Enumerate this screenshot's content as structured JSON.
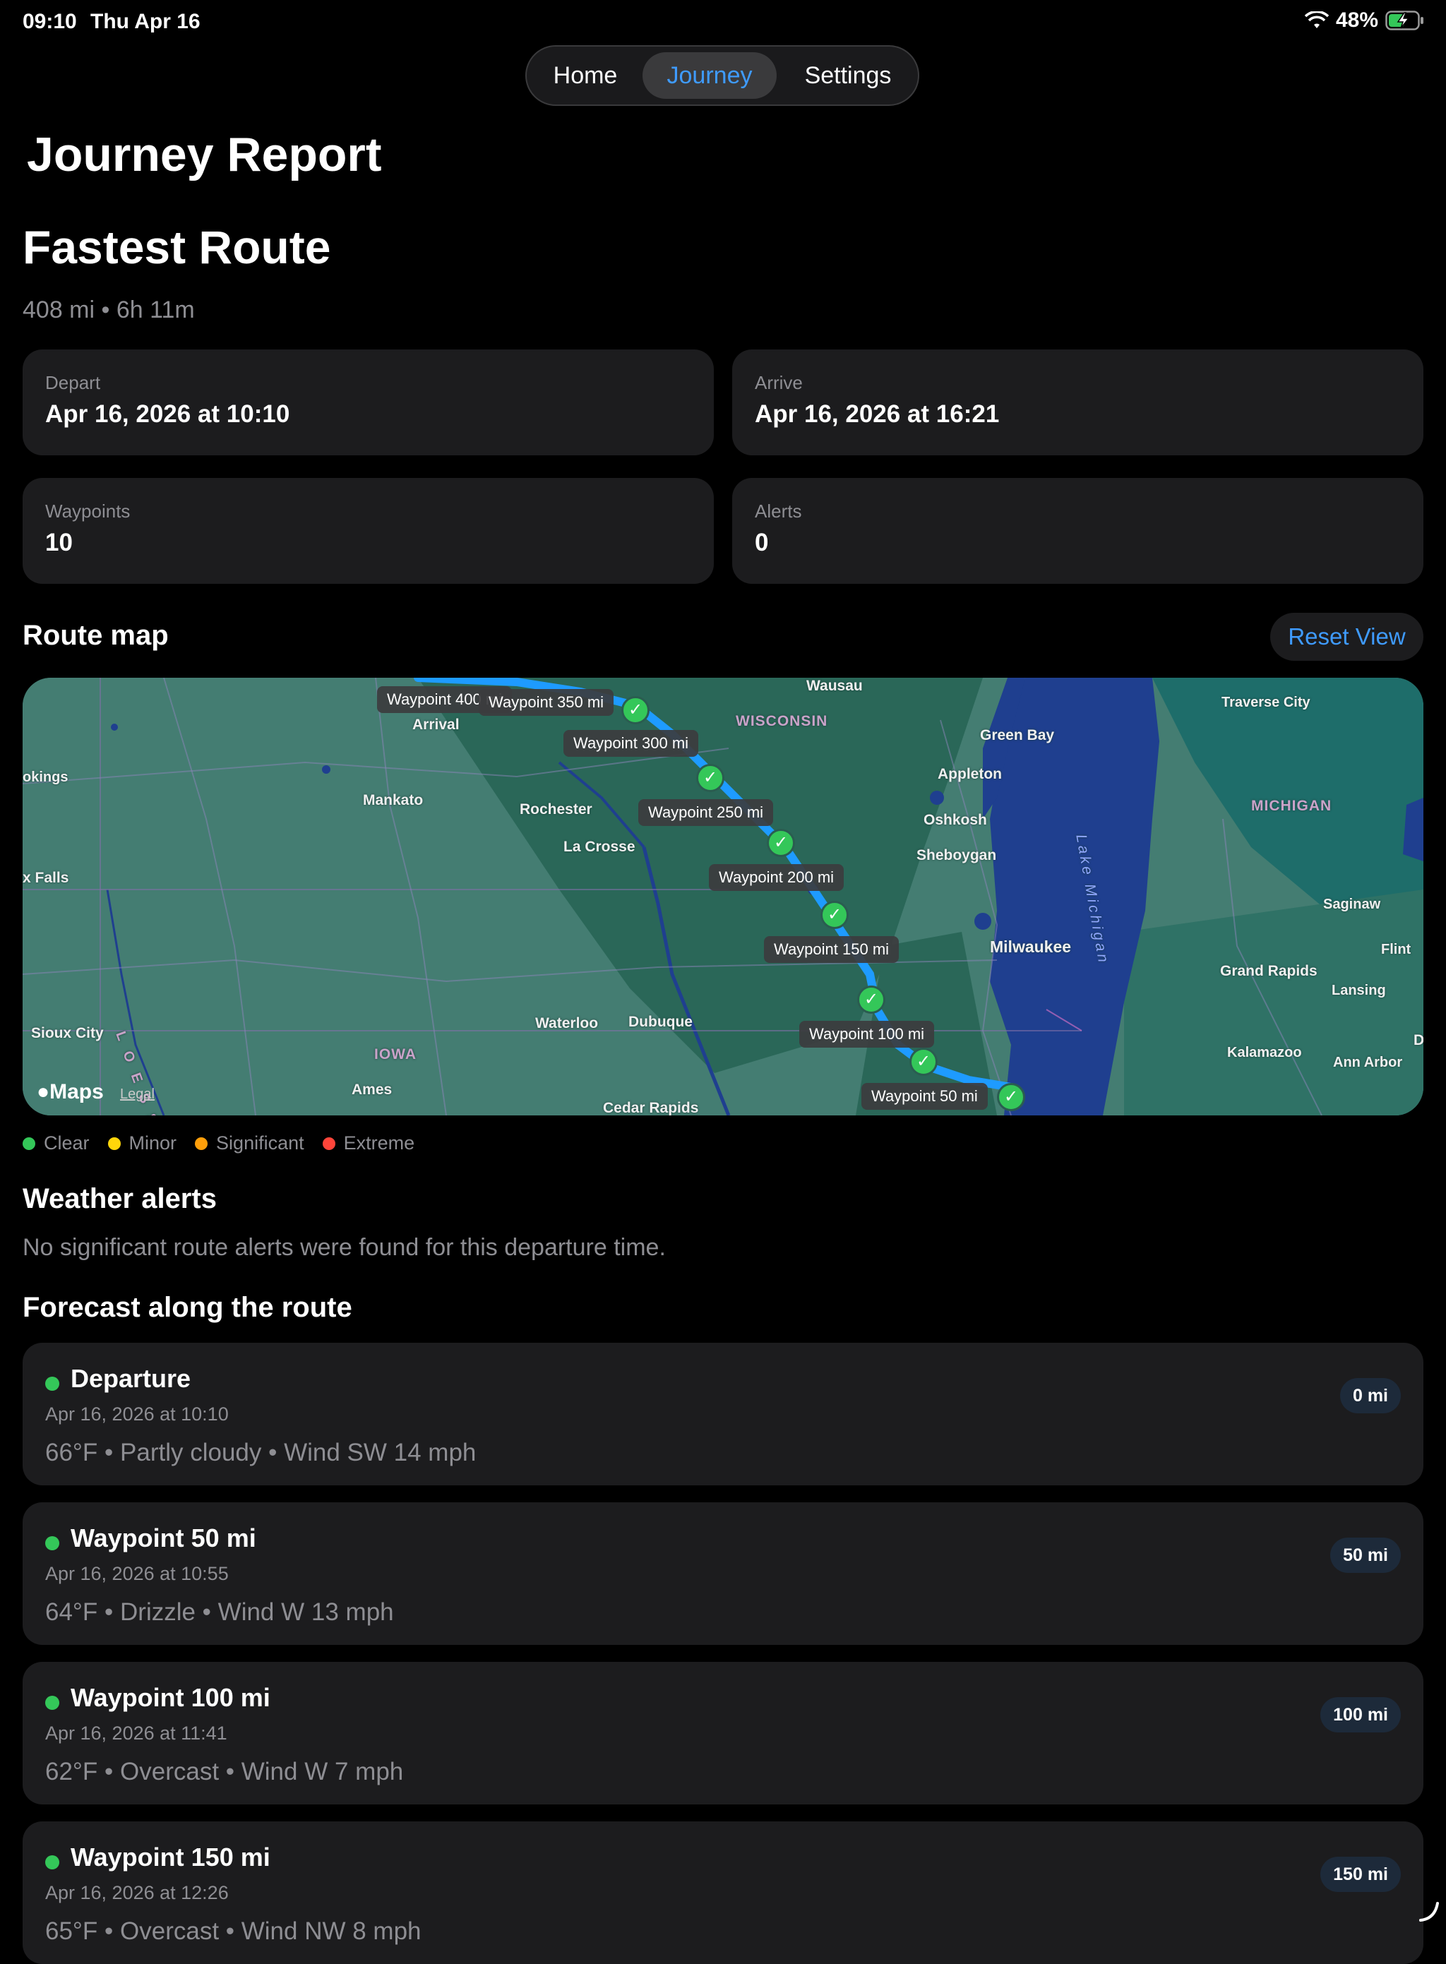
{
  "status_bar": {
    "time": "09:10",
    "date": "Thu Apr 16",
    "battery": "48%"
  },
  "tabs": {
    "home": "Home",
    "journey": "Journey",
    "settings": "Settings",
    "selected": "Journey"
  },
  "page_title": "Journey Report",
  "route": {
    "title": "Fastest Route",
    "summary": "408 mi • 6h 11m"
  },
  "stats": {
    "depart": {
      "label": "Depart",
      "value": "Apr 16, 2026 at 10:10"
    },
    "arrive": {
      "label": "Arrive",
      "value": "Apr 16, 2026 at 16:21"
    },
    "waypoints": {
      "label": "Waypoints",
      "value": "10"
    },
    "alerts": {
      "label": "Alerts",
      "value": "0"
    }
  },
  "route_map": {
    "heading": "Route map",
    "reset_label": "Reset View",
    "maps_brand": "Maps",
    "legal": "Legal",
    "waypoint_labels": [
      "Waypoint 400 mi",
      "Waypoint 350 mi",
      "Waypoint 300 mi",
      "Waypoint 250 mi",
      "Waypoint 200 mi",
      "Waypoint 150 mi",
      "Waypoint 100 mi",
      "Waypoint 50 mi"
    ],
    "places": {
      "wausau": "Wausau",
      "arrival": "Arrival",
      "wisconsin": "WISCONSIN",
      "green_bay": "Green Bay",
      "traverse_city": "Traverse City",
      "brookings": "okings",
      "mankato": "Mankato",
      "rochester": "Rochester",
      "appleton": "Appleton",
      "oshkosh": "Oshkosh",
      "michigan": "MICHIGAN",
      "la_crosse": "La Crosse",
      "sheboygan": "Sheboygan",
      "sioux_falls": "x Falls",
      "saginaw": "Saginaw",
      "milwaukee": "Milwaukee",
      "flint": "Flint",
      "grand_rapids": "Grand Rapids",
      "lansing": "Lansing",
      "sioux_city": "Sioux City",
      "waterloo": "Waterloo",
      "dubuque": "Dubuque",
      "iowa": "IOWA",
      "kalamazoo": "Kalamazoo",
      "ann_arbor": "Ann Arbor",
      "ames": "Ames",
      "cedar_rapids": "Cedar Rapids",
      "lake_michigan": "Lake Michigan",
      "loess": "L O E S S",
      "detroit_edge": "D"
    }
  },
  "legend": [
    {
      "label": "Clear",
      "color": "#34c759"
    },
    {
      "label": "Minor",
      "color": "#ffd60a"
    },
    {
      "label": "Significant",
      "color": "#ff9f0a"
    },
    {
      "label": "Extreme",
      "color": "#ff453a"
    }
  ],
  "weather_alerts": {
    "heading": "Weather alerts",
    "text": "No significant route alerts were found for this departure time."
  },
  "forecast": {
    "heading": "Forecast along the route",
    "items": [
      {
        "name": "Departure",
        "time": "Apr 16, 2026 at 10:10",
        "weather": "66°F • Partly cloudy • Wind SW 14 mph",
        "distance": "0 mi",
        "status_color": "#34c759"
      },
      {
        "name": "Waypoint 50 mi",
        "time": "Apr 16, 2026 at 10:55",
        "weather": "64°F • Drizzle • Wind W 13 mph",
        "distance": "50 mi",
        "status_color": "#34c759"
      },
      {
        "name": "Waypoint 100 mi",
        "time": "Apr 16, 2026 at 11:41",
        "weather": "62°F • Overcast • Wind W 7 mph",
        "distance": "100 mi",
        "status_color": "#34c759"
      },
      {
        "name": "Waypoint 150 mi",
        "time": "Apr 16, 2026 at 12:26",
        "weather": "65°F • Overcast • Wind NW 8 mph",
        "distance": "150 mi",
        "status_color": "#34c759"
      }
    ]
  }
}
